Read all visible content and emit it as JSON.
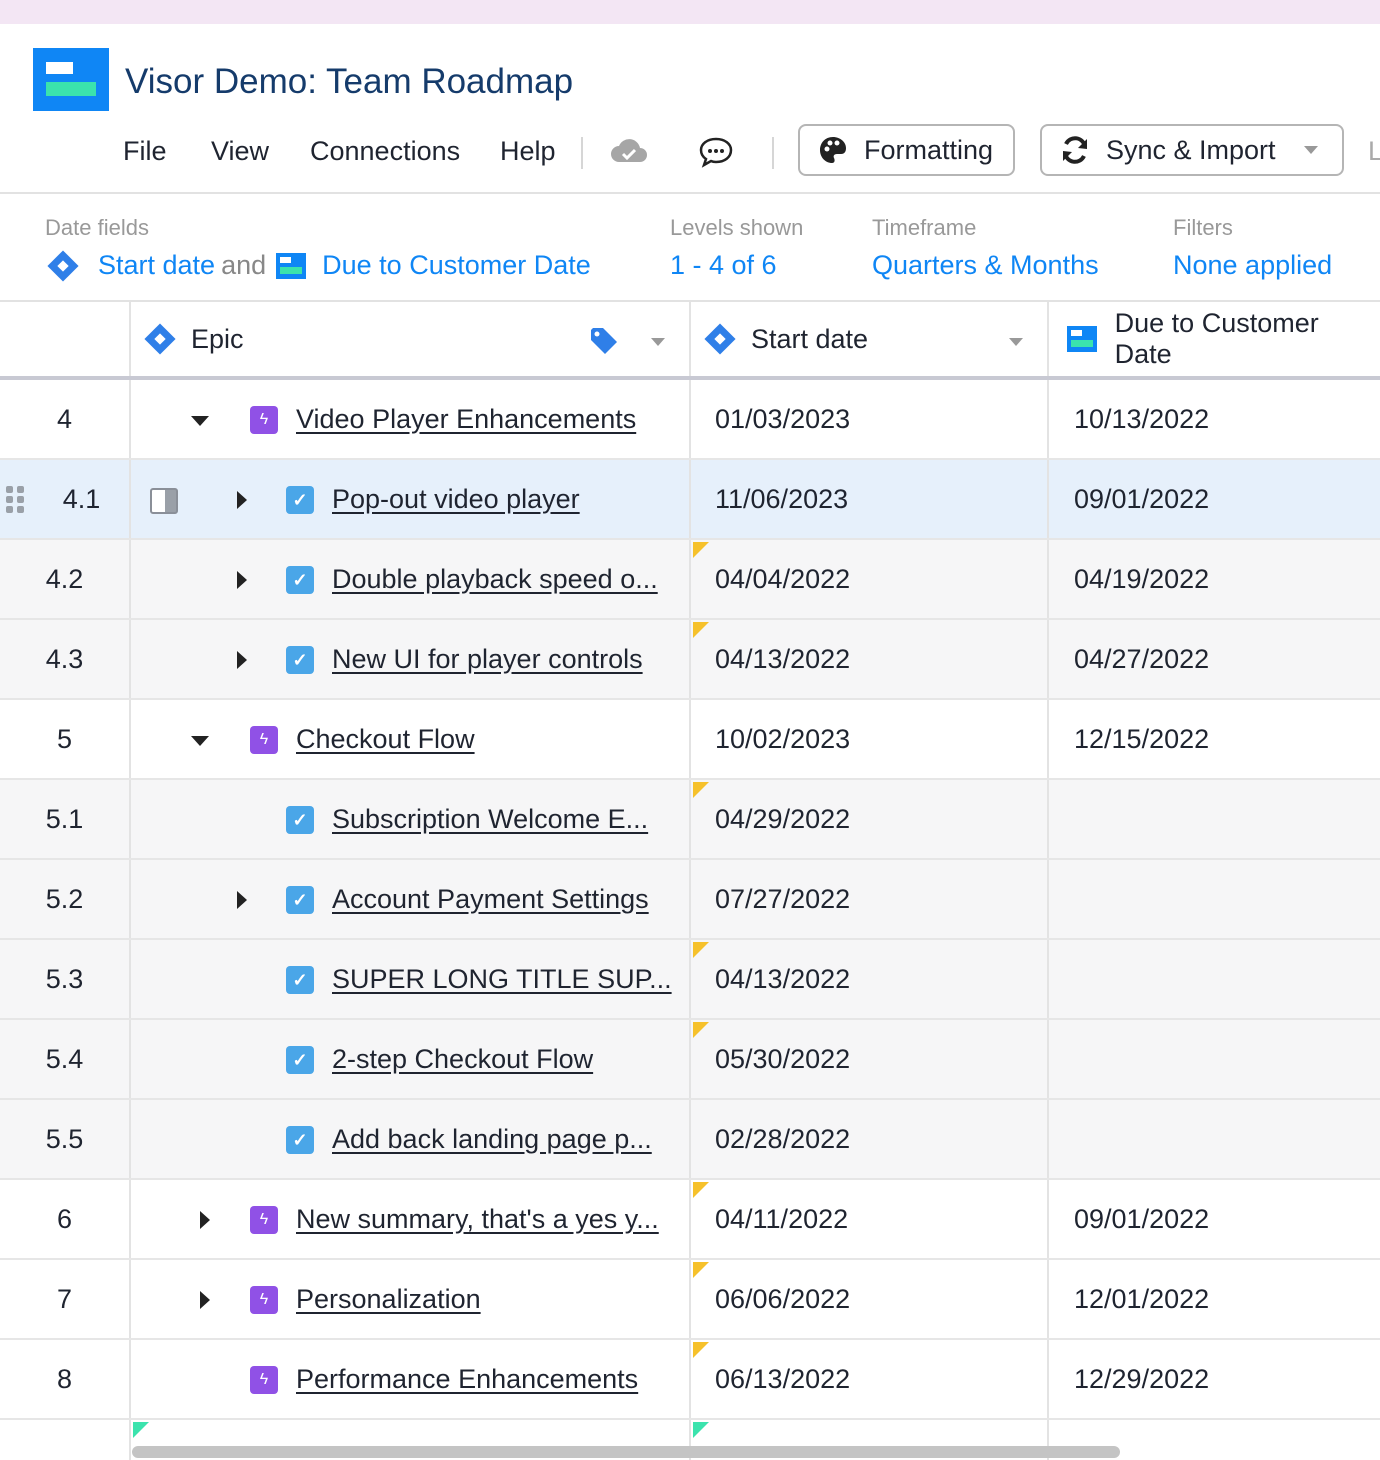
{
  "app": {
    "title": "Visor Demo: Team Roadmap"
  },
  "menu": {
    "file": "File",
    "view": "View",
    "connections": "Connections",
    "help": "Help"
  },
  "toolbar": {
    "formatting": "Formatting",
    "sync": "Sync & Import",
    "cutoff": "L"
  },
  "filters": {
    "date_fields_label": "Date fields",
    "date_field_1": "Start date",
    "date_and": "and",
    "date_field_2": "Due to Customer Date",
    "levels_label": "Levels shown",
    "levels_value": "1 - 4 of 6",
    "timeframe_label": "Timeframe",
    "timeframe_value": "Quarters & Months",
    "filters_label": "Filters",
    "filters_value": "None applied"
  },
  "columns": {
    "epic": "Epic",
    "start": "Start date",
    "due": "Due to Customer Date"
  },
  "colors": {
    "accent": "#0f86f5",
    "epic": "#9051e6",
    "task": "#4aa6e8",
    "flag": "#f6c12b",
    "selected": "#e6f0fb"
  },
  "rows": [
    {
      "num": "4",
      "title": "Video Player Enhancements",
      "start": "01/03/2023",
      "due": "10/13/2022"
    },
    {
      "num": "4.1",
      "title": "Pop-out video player",
      "start": "11/06/2023",
      "due": "09/01/2022"
    },
    {
      "num": "4.2",
      "title": "Double playback speed o...",
      "start": "04/04/2022",
      "due": "04/19/2022"
    },
    {
      "num": "4.3",
      "title": "New UI for player controls",
      "start": "04/13/2022",
      "due": "04/27/2022"
    },
    {
      "num": "5",
      "title": "Checkout Flow",
      "start": "10/02/2023",
      "due": "12/15/2022"
    },
    {
      "num": "5.1",
      "title": "Subscription Welcome E...",
      "start": "04/29/2022",
      "due": ""
    },
    {
      "num": "5.2",
      "title": "Account Payment Settings",
      "start": "07/27/2022",
      "due": ""
    },
    {
      "num": "5.3",
      "title": "SUPER LONG TITLE SUP...",
      "start": "04/13/2022",
      "due": ""
    },
    {
      "num": "5.4",
      "title": "2-step Checkout Flow",
      "start": "05/30/2022",
      "due": ""
    },
    {
      "num": "5.5",
      "title": "Add back landing page p...",
      "start": "02/28/2022",
      "due": ""
    },
    {
      "num": "6",
      "title": "New summary, that's a yes y...",
      "start": "04/11/2022",
      "due": "09/01/2022"
    },
    {
      "num": "7",
      "title": "Personalization",
      "start": "06/06/2022",
      "due": "12/01/2022"
    },
    {
      "num": "8",
      "title": "Performance Enhancements",
      "start": "06/13/2022",
      "due": "12/29/2022"
    }
  ]
}
